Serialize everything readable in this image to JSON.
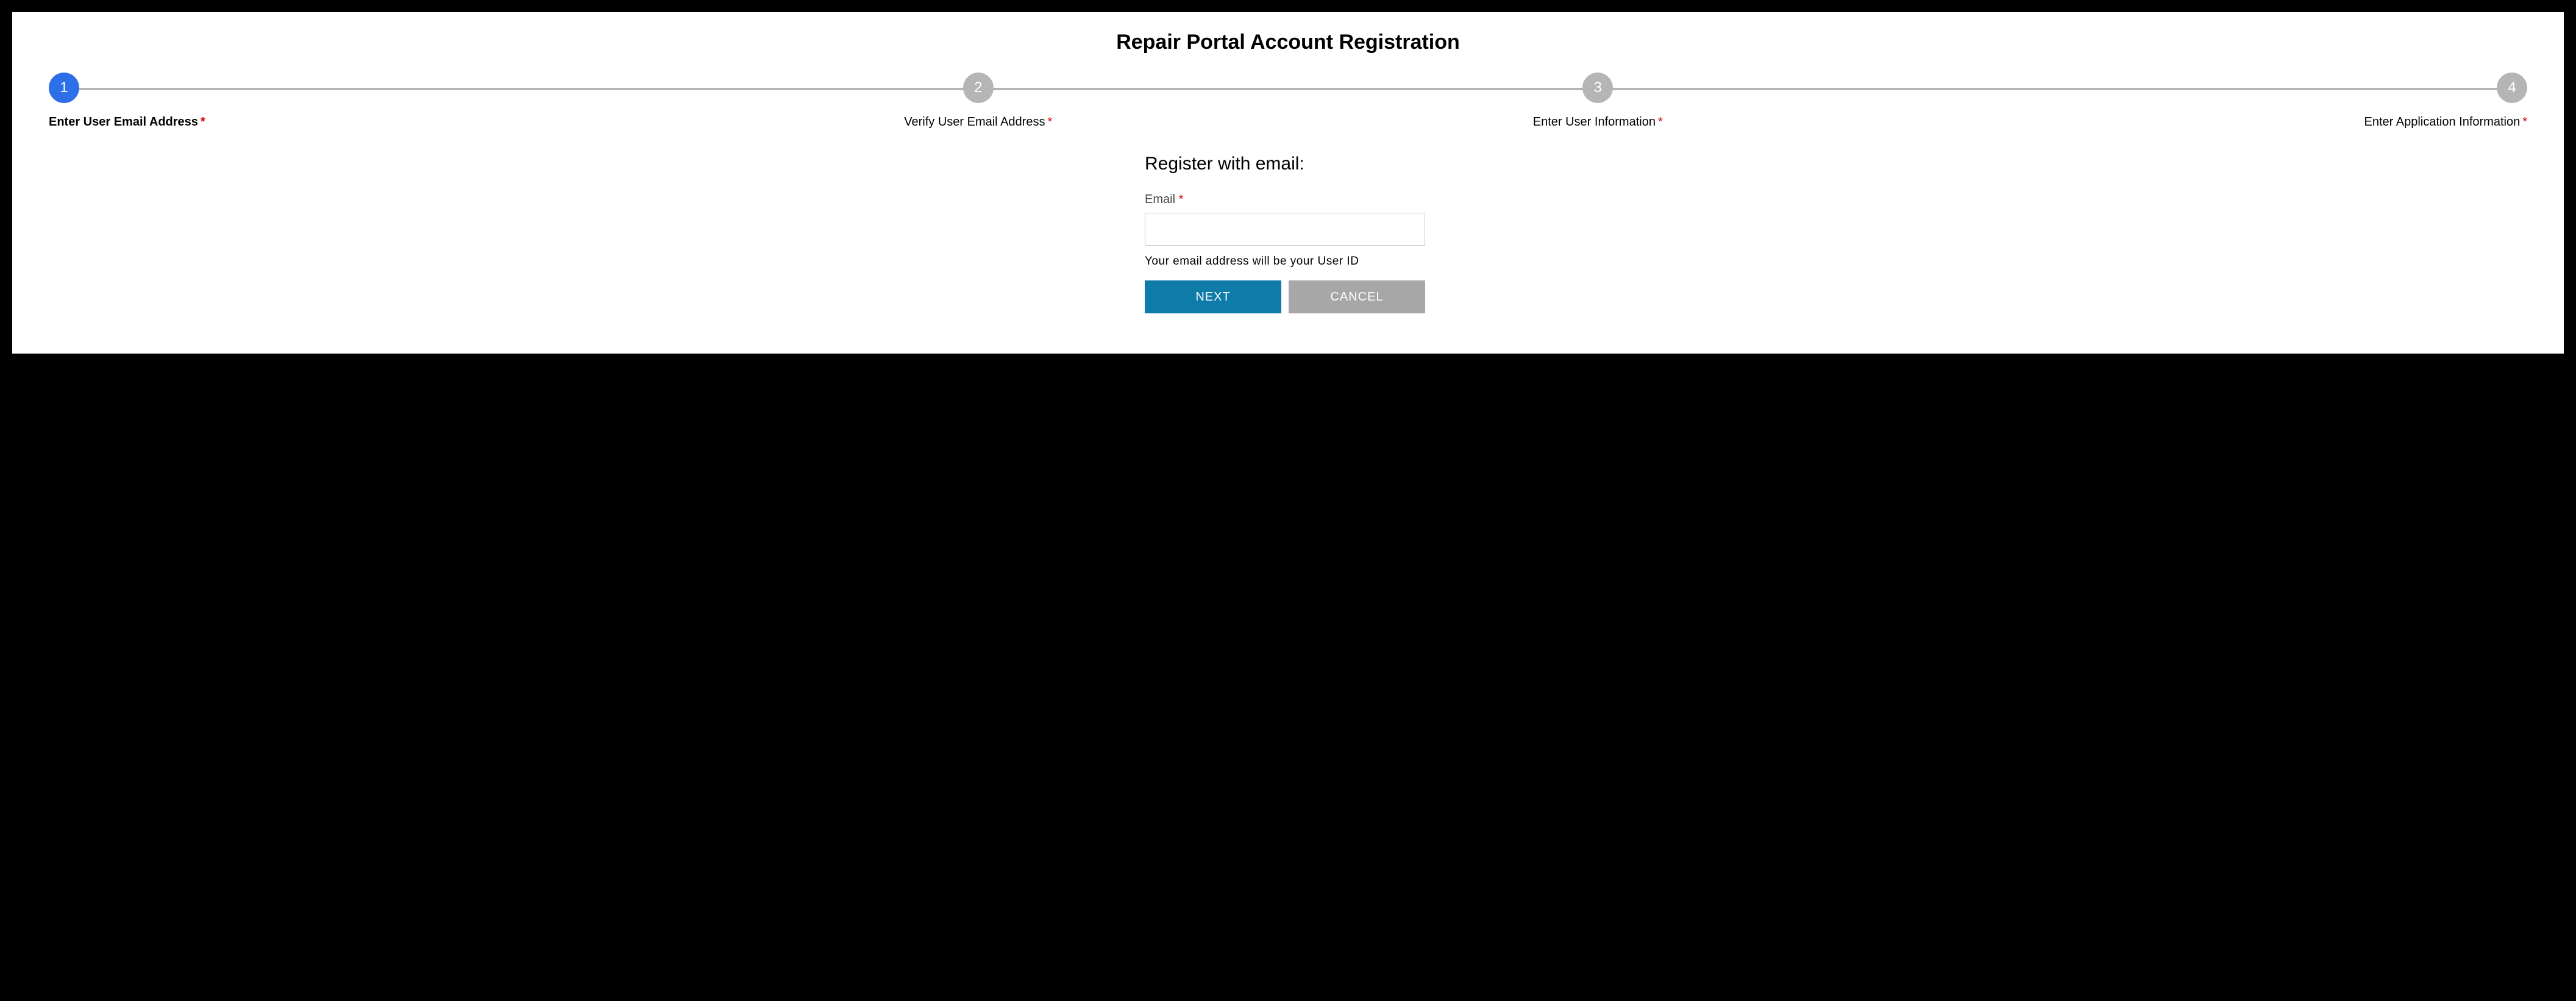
{
  "title": "Repair Portal Account Registration",
  "steps": [
    {
      "num": "1",
      "label": "Enter User Email Address",
      "active": true
    },
    {
      "num": "2",
      "label": "Verify User Email Address",
      "active": false
    },
    {
      "num": "3",
      "label": "Enter User Information",
      "active": false
    },
    {
      "num": "4",
      "label": "Enter Application Information",
      "active": false
    }
  ],
  "required_marker": "*",
  "form": {
    "heading": "Register with email:",
    "email_label": "Email",
    "email_value": "",
    "hint": "Your email address will be your User ID",
    "next_label": "NEXT",
    "cancel_label": "CANCEL"
  }
}
